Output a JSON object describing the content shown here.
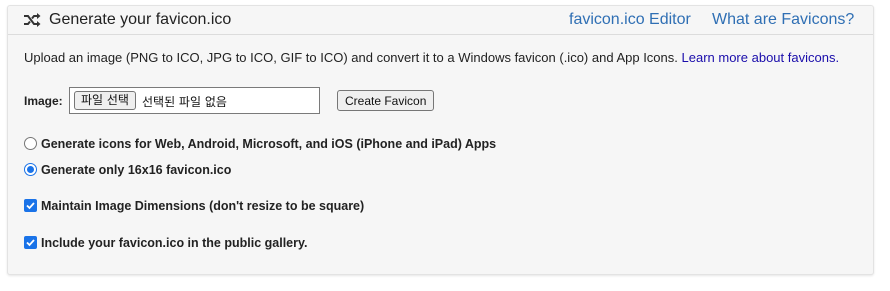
{
  "header": {
    "title": "Generate your favicon.ico",
    "links": [
      "favicon.ico Editor",
      "What are Favicons?"
    ],
    "icon": "shuffle-icon"
  },
  "description": {
    "text": "Upload an image (PNG to ICO, JPG to ICO, GIF to ICO) and convert it to a Windows favicon (.ico) and App Icons.",
    "link": "Learn more about favicons."
  },
  "form": {
    "image_label": "Image:",
    "file_button": "파일 선택",
    "file_status": "선택된 파일 없음",
    "create_button": "Create Favicon",
    "options": [
      {
        "type": "radio",
        "checked": false,
        "label": "Generate icons for Web, Android, Microsoft, and iOS (iPhone and iPad) Apps"
      },
      {
        "type": "radio",
        "checked": true,
        "label": "Generate only 16x16 favicon.ico"
      },
      {
        "type": "checkbox",
        "checked": true,
        "label": "Maintain Image Dimensions (don't resize to be square)"
      },
      {
        "type": "checkbox",
        "checked": true,
        "label": "Include your favicon.ico in the public gallery."
      }
    ]
  },
  "colors": {
    "link": "#2f6fb4",
    "accent": "#1a73e8",
    "panel": "#f6f6f6"
  }
}
